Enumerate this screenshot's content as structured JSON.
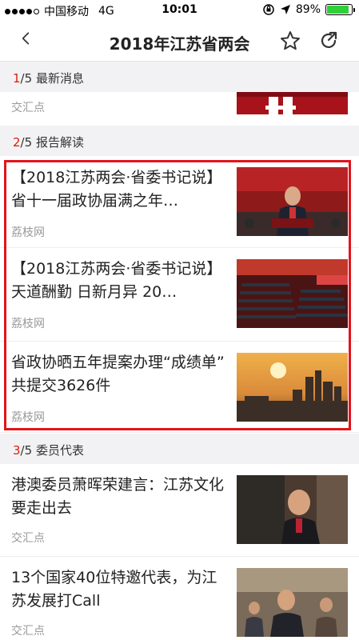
{
  "status_bar": {
    "carrier": "中国移动",
    "network": "4G",
    "time": "10:01",
    "battery_percent": "89%",
    "battery_level": 0.89
  },
  "nav": {
    "title": "2018年江苏省两会",
    "back_icon": "back-chevron-icon",
    "favorite_icon": "star-icon",
    "share_icon": "share-icon"
  },
  "sections": [
    {
      "index": "1",
      "total": "/5",
      "name": "最新消息"
    },
    {
      "index": "2",
      "total": "/5",
      "name": "报告解读"
    },
    {
      "index": "3",
      "total": "/5",
      "name": "委员代表"
    }
  ],
  "articles": {
    "partial": {
      "source": "交汇点"
    },
    "report": [
      {
        "title": "【2018江苏两会·省委书记说】省十一届政协届满之年…",
        "source": "荔枝网"
      },
      {
        "title": "【2018江苏两会·省委书记说】天道酬勤 日新月异 20…",
        "source": "荔枝网"
      },
      {
        "title": "省政协晒五年提案办理“成绩单” 共提交3626件",
        "source": "荔枝网"
      }
    ],
    "members": [
      {
        "title": "港澳委员萧晖荣建言：江苏文化要走出去",
        "source": "交汇点"
      },
      {
        "title": "13个国家40位特邀代表，为江苏发展打Call",
        "source": "交汇点"
      }
    ]
  },
  "colors": {
    "accent": "#d81e06",
    "highlight_border": "#e2141b",
    "section_bg": "#f2f2f4"
  }
}
